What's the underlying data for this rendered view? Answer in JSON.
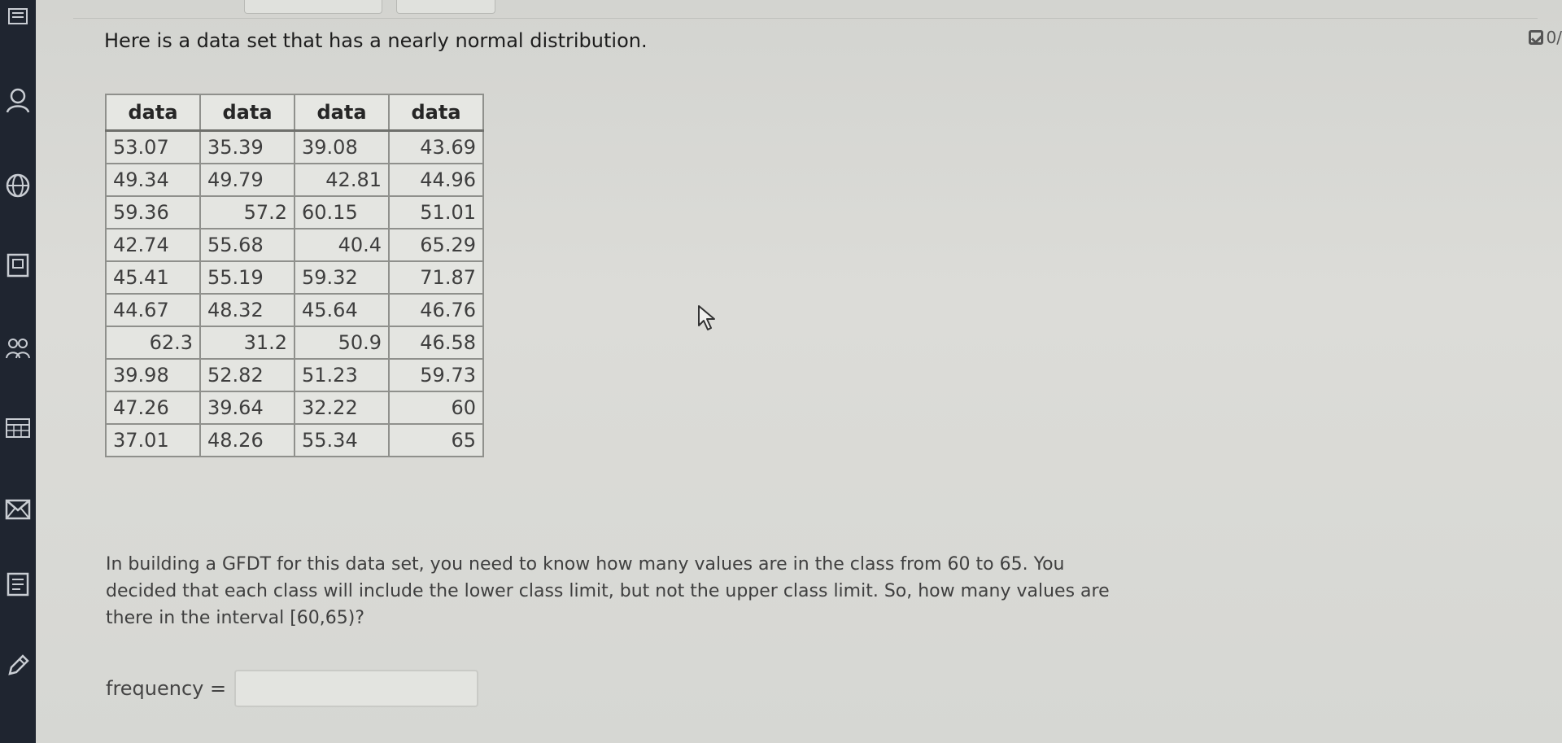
{
  "intro": "Here is a data set that has a nearly normal distribution.",
  "status": {
    "label": "0/"
  },
  "table": {
    "headers": [
      "data",
      "data",
      "data",
      "data"
    ],
    "rows": [
      [
        "53.07",
        "35.39",
        "39.08",
        "43.69"
      ],
      [
        "49.34",
        "49.79",
        "42.81",
        "44.96"
      ],
      [
        "59.36",
        "57.2",
        "60.15",
        "51.01"
      ],
      [
        "42.74",
        "55.68",
        "40.4",
        "65.29"
      ],
      [
        "45.41",
        "55.19",
        "59.32",
        "71.87"
      ],
      [
        "44.67",
        "48.32",
        "45.64",
        "46.76"
      ],
      [
        "62.3",
        "31.2",
        "50.9",
        "46.58"
      ],
      [
        "39.98",
        "52.82",
        "51.23",
        "59.73"
      ],
      [
        "47.26",
        "39.64",
        "32.22",
        "60"
      ],
      [
        "37.01",
        "48.26",
        "55.34",
        "65"
      ]
    ]
  },
  "question": "In building a GFDT for this data set, you need to know how many values are in the class from 60 to 65. You decided that each class will include the lower class limit, but not the upper class limit. So, how many values are there in the interval [60,65)?",
  "answer": {
    "label": "frequency =",
    "value": ""
  },
  "rail_icons": [
    "user-icon",
    "globe-icon",
    "book-icon",
    "people-icon",
    "calendar-icon",
    "mail-icon",
    "document-icon",
    "pencil-icon"
  ]
}
